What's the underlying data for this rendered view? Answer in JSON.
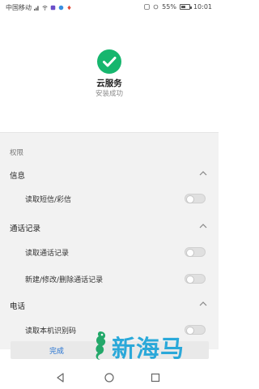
{
  "status_bar": {
    "carrier": "中国移动",
    "battery": "55%",
    "battery_level": 0.55,
    "time": "10:01"
  },
  "header": {
    "app_name": "云服务",
    "install_status": "安装成功",
    "success_color": "#16b66e"
  },
  "permissions": {
    "section_label": "权限",
    "groups": [
      {
        "title": "信息",
        "items": [
          {
            "label": "读取短信/彩信",
            "enabled": false
          }
        ]
      },
      {
        "title": "通话记录",
        "items": [
          {
            "label": "读取通话记录",
            "enabled": false
          },
          {
            "label": "新建/修改/删除通话记录",
            "enabled": false
          }
        ]
      },
      {
        "title": "电话",
        "items": [
          {
            "label": "读取本机识别码",
            "enabled": false
          }
        ]
      }
    ]
  },
  "footer": {
    "done_label": "完成",
    "watermark_text": "新海马",
    "accent": "#1f6fd0"
  },
  "nav": {
    "icons": [
      "back-icon",
      "home-icon",
      "recents-icon"
    ]
  }
}
